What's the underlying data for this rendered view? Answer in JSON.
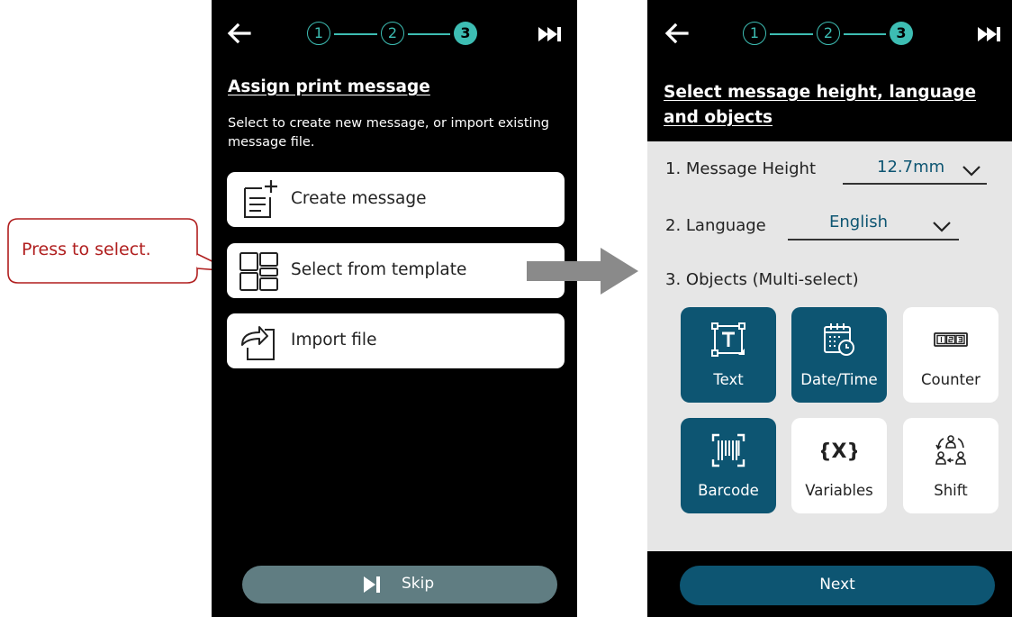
{
  "callout": {
    "text": "Press to select."
  },
  "left_screen": {
    "steps": [
      "1",
      "2",
      "3"
    ],
    "title": "Assign print message",
    "subtitle": "Select to create new message, or import existing message file.",
    "options": [
      {
        "label": "Create message",
        "icon": "create-message-icon"
      },
      {
        "label": "Select from template",
        "icon": "template-grid-icon"
      },
      {
        "label": "Import file",
        "icon": "import-file-icon"
      }
    ],
    "skip_label": "Skip"
  },
  "right_screen": {
    "steps": [
      "1",
      "2",
      "3"
    ],
    "title": "Select message height, language and objects",
    "height_label": "1. Message Height",
    "height_value": "12.7mm",
    "language_label": "2. Language",
    "language_value": "English",
    "objects_label": "3. Objects (Multi-select)",
    "objects": [
      {
        "label": "Text",
        "selected": true,
        "icon": "text-icon"
      },
      {
        "label": "Date/Time",
        "selected": true,
        "icon": "date-time-icon"
      },
      {
        "label": "Counter",
        "selected": false,
        "icon": "counter-icon"
      },
      {
        "label": "Barcode",
        "selected": true,
        "icon": "barcode-icon"
      },
      {
        "label": "Variables",
        "selected": false,
        "icon": "variables-icon"
      },
      {
        "label": "Shift",
        "selected": false,
        "icon": "shift-icon"
      }
    ],
    "next_label": "Next"
  },
  "colors": {
    "accent_teal": "#3dbdb3",
    "selected_tile": "#0d5572",
    "skip_button": "#607d82",
    "callout_red": "#b01e1e"
  }
}
